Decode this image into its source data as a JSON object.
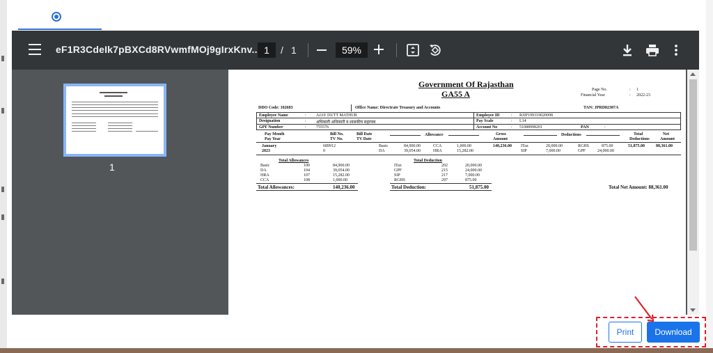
{
  "toolbar": {
    "title": "eF1R3CdeIk7pBXCd8RVwmfMOj9gIrxKnv...",
    "current_page": "1",
    "page_separator": "/",
    "total_pages": "1",
    "zoom": "59%"
  },
  "thumbnail": {
    "page_number": "1"
  },
  "document": {
    "heading": "Government Of Rajasthan",
    "subheading": "GA55 A",
    "page_no_label": "Page No.",
    "page_no_colon": ":",
    "page_no_value": "1",
    "fy_label": "Financial Year",
    "fy_colon": ":",
    "fy_value": "2022-23",
    "ddo_code": "DDO Code: 102683",
    "office_name": "Office Name: Directrate Treasury and Accounts",
    "tan": "TAN: JPRD02387A",
    "rows": {
      "emp_name_label": "Employee Name",
      "emp_name_value": "AJAY DUTT MATHUR",
      "emp_id_label": "Employee ID",
      "emp_id_value": "RJJP199319020098",
      "designation_label": "Designation",
      "designation_value": "अधिकारी अधिकारी व शासकीय सहायक",
      "pay_scale_label": "Pay Scale",
      "pay_scale_value": "L14",
      "gpf_label": "GPF Number",
      "gpf_value": "755576",
      "account_label": "Account No",
      "account_value": "51088998201",
      "pan_label": "PAN",
      "colon": ":"
    },
    "headers": {
      "pay_month": "Pay Month",
      "pay_year": "Pay Year",
      "bill_no": "Bill No.",
      "tv_no": "TV No.",
      "bill_date": "Bill Date",
      "tv_date": "TV Date",
      "allowance": "Allowance",
      "gross": "Gross",
      "amount": "Amount",
      "deductions": "Deductions",
      "total": "Total",
      "total_ded": "Deductions",
      "net": "Net",
      "net_amount": "Amount"
    },
    "entry": {
      "month": "January",
      "year": "2023",
      "bill_no": "689912",
      "tv_no": "0",
      "a1_name": "Basic",
      "a1_val": "84,900.00",
      "a2_name": "CCA",
      "a2_val": "1,000.00",
      "a3_name": "DA",
      "a3_val": "39,054.00",
      "a4_name": "HRA",
      "a4_val": "15,282.00",
      "gross": "140,236.00",
      "d1_name": "ITax",
      "d1_val": "20,000.00",
      "d2_name": "RGHS",
      "d2_val": "875.00",
      "d3_name": "SIP",
      "d3_val": "7,000.00",
      "d4_name": "GPF",
      "d4_val": "24,000.00",
      "total_ded": "51,875.00",
      "net": "88,361.00"
    },
    "total_allowances": {
      "title": "Total Allowances",
      "items": [
        {
          "name": "Basic",
          "code": "100",
          "amount": "84,900.00"
        },
        {
          "name": "DA",
          "code": "104",
          "amount": "39,054.00"
        },
        {
          "name": "HRA",
          "code": "107",
          "amount": "15,282.00"
        },
        {
          "name": "CCA",
          "code": "108",
          "amount": "1,000.00"
        }
      ],
      "total_label": "Total Allowances:",
      "total_value": "140,236.00"
    },
    "total_deduction": {
      "title": "Total Deduction",
      "items": [
        {
          "name": "ITax",
          "code": "202",
          "amount": "20,000.00"
        },
        {
          "name": "GPF",
          "code": "215",
          "amount": "24,000.00"
        },
        {
          "name": "SIP",
          "code": "217",
          "amount": "7,000.00"
        },
        {
          "name": "RGHS",
          "code": "297",
          "amount": "875.00"
        }
      ],
      "total_label": "Total Deduction:",
      "total_value": "51,875.00"
    },
    "net_amount": "Total Net Amount: 88,361.00"
  },
  "actions": {
    "print_label": "Print",
    "download_label": "Download"
  },
  "colors": {
    "accent": "#1a73e8",
    "toolbar_bg": "#323639",
    "viewer_bg": "#525659",
    "highlight": "#e0202a"
  },
  "icons": [
    "menu-icon",
    "download-icon",
    "print-icon",
    "more-vert-icon",
    "fit-page-icon",
    "rotate-icon"
  ]
}
